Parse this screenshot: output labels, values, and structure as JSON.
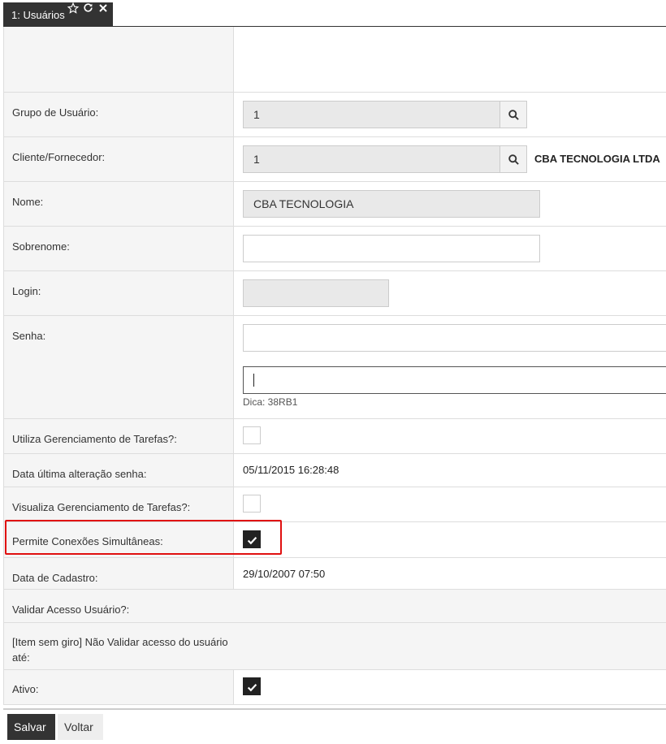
{
  "tab": {
    "label": "1: Usuários",
    "icons": [
      "star-outline-icon",
      "refresh-icon",
      "close-icon"
    ]
  },
  "fields": {
    "grupo": {
      "label": "Grupo de Usuário:",
      "value": "1"
    },
    "cliente": {
      "label": "Cliente/Fornecedor:",
      "value": "1",
      "extra": "CBA TECNOLOGIA LTDA"
    },
    "nome": {
      "label": "Nome:",
      "value": "CBA TECNOLOGIA"
    },
    "sobrenome": {
      "label": "Sobrenome:",
      "value": ""
    },
    "login": {
      "label": "Login:",
      "value": ""
    },
    "senha": {
      "label": "Senha:",
      "value": "",
      "confirm_value": "",
      "hint": "Dica: 38RB1"
    },
    "utiliza_tarefas": {
      "label": "Utiliza Gerenciamento de Tarefas?:",
      "checked": false
    },
    "data_alteracao_senha": {
      "label": "Data última alteração senha:",
      "value": "05/11/2015 16:28:48"
    },
    "visualiza_tarefas": {
      "label": "Visualiza Gerenciamento de Tarefas?:",
      "checked": false
    },
    "conexoes_simultaneas": {
      "label": "Permite Conexões Simultâneas:",
      "checked": true
    },
    "data_cadastro": {
      "label": "Data de Cadastro:",
      "value": "29/10/2007 07:50"
    },
    "validar_acesso": {
      "label": "Validar Acesso Usuário?:"
    },
    "nao_validar": {
      "label": "[Item sem giro] Não Validar acesso do usuário até:"
    },
    "ativo": {
      "label": "Ativo:",
      "checked": true
    }
  },
  "buttons": {
    "save": "Salvar",
    "back": "Voltar"
  },
  "colors": {
    "highlight": "#e01010",
    "tab_bg": "#333333",
    "checkbox_on": "#222222"
  }
}
